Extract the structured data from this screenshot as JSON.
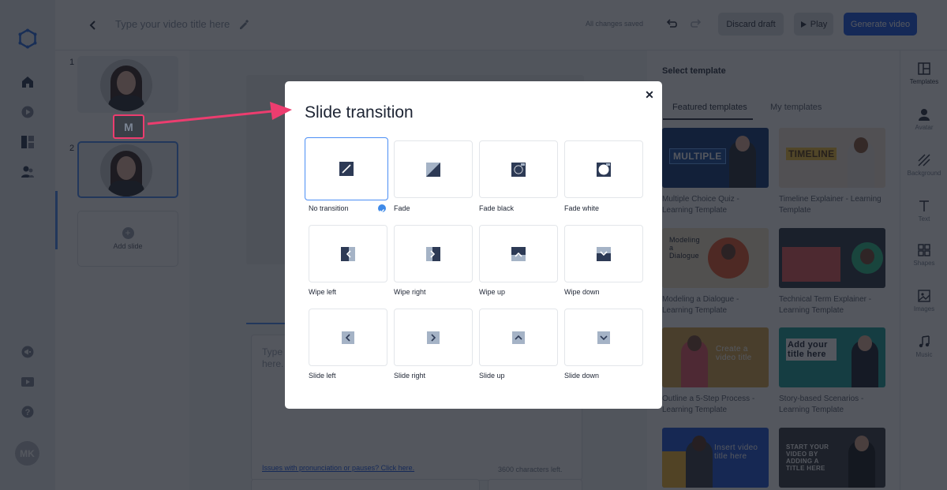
{
  "topbar": {
    "video_title_placeholder": "Type your video title here",
    "save_status": "All changes saved",
    "discard_label": "Discard draft",
    "play_label": "Play",
    "generate_label": "Generate video"
  },
  "slides": {
    "items": [
      {
        "number": "1",
        "selected": false
      },
      {
        "number": "2",
        "selected": true
      }
    ],
    "transition_marker_glyph": "M",
    "add_slide_label": "Add slide"
  },
  "script": {
    "placeholder": "Type here.",
    "issues_link": "Issues with pronunciation or pauses? Click here.",
    "chars_left": "3600 characters left."
  },
  "templates_panel": {
    "title": "Select template",
    "tabs": [
      {
        "label": "Featured templates",
        "active": true
      },
      {
        "label": "My templates",
        "active": false
      }
    ],
    "templates": [
      {
        "name": "Multiple Choice Quiz - Learning Template",
        "thumb_text": "MULTIPLE"
      },
      {
        "name": "Timeline Explainer - Learning Template",
        "thumb_text": "TIMELINE"
      },
      {
        "name": "Modeling a Dialogue - Learning Template",
        "thumb_text": "Modeling a Dialogue"
      },
      {
        "name": "Technical Term Explainer - Learning Template",
        "thumb_text": ""
      },
      {
        "name": "Outline a 5-Step Process - Learning Template",
        "thumb_text": "Create a video title"
      },
      {
        "name": "Story-based Scenarios - Learning Template",
        "thumb_text": "Add your title here"
      },
      {
        "name": "",
        "thumb_text": "Insert video title here"
      },
      {
        "name": "",
        "thumb_text": "START YOUR VIDEO BY ADDING A TITLE HERE"
      }
    ]
  },
  "iconbar": {
    "items": [
      {
        "label": "Templates",
        "icon": "templates-icon",
        "active": true
      },
      {
        "label": "Avatar",
        "icon": "avatar-icon",
        "active": false
      },
      {
        "label": "Background",
        "icon": "background-icon",
        "active": false
      },
      {
        "label": "Text",
        "icon": "text-icon",
        "active": false
      },
      {
        "label": "Shapes",
        "icon": "shapes-icon",
        "active": false
      },
      {
        "label": "Images",
        "icon": "images-icon",
        "active": false
      },
      {
        "label": "Music",
        "icon": "music-icon",
        "active": false
      }
    ]
  },
  "left_rail": {
    "user_initials": "MK"
  },
  "modal": {
    "title": "Slide transition",
    "options": [
      {
        "label": "No transition",
        "selected": true
      },
      {
        "label": "Fade",
        "selected": false
      },
      {
        "label": "Fade black",
        "selected": false
      },
      {
        "label": "Fade white",
        "selected": false
      },
      {
        "label": "Wipe left",
        "selected": false
      },
      {
        "label": "Wipe right",
        "selected": false
      },
      {
        "label": "Wipe up",
        "selected": false
      },
      {
        "label": "Wipe down",
        "selected": false
      },
      {
        "label": "Slide left",
        "selected": false
      },
      {
        "label": "Slide right",
        "selected": false
      },
      {
        "label": "Slide up",
        "selected": false
      },
      {
        "label": "Slide down",
        "selected": false
      }
    ]
  },
  "colors": {
    "accent": "#1f5be6",
    "highlight_arrow": "#ec3d6f",
    "selection": "#4b8ef5",
    "icon_dark": "#2d3a55"
  }
}
